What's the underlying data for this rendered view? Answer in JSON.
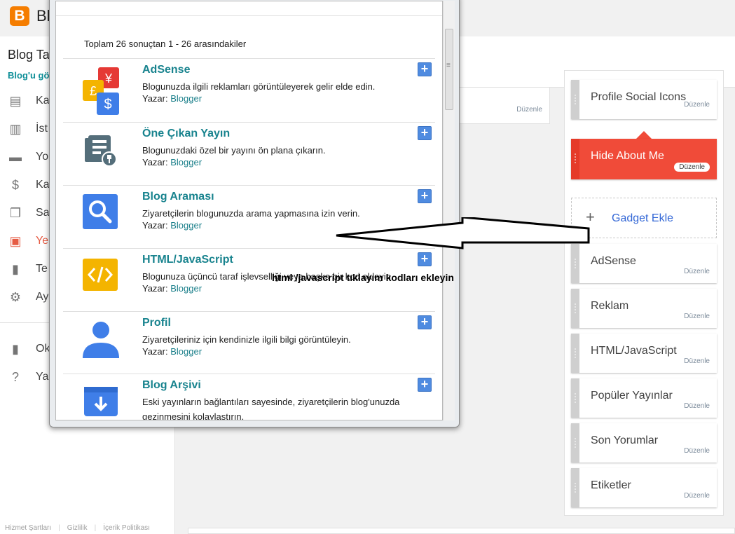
{
  "app": {
    "logo_letter": "B",
    "brand": "Bl"
  },
  "sidebar": {
    "blog_title": "Blog Ta",
    "blog_link": "Blog'u gö",
    "items": [
      {
        "label": "Ka",
        "icon": "posts-icon"
      },
      {
        "label": "İst",
        "icon": "stats-icon"
      },
      {
        "label": "Yo",
        "icon": "comments-icon"
      },
      {
        "label": "Ka",
        "icon": "earnings-icon"
      },
      {
        "label": "Sa",
        "icon": "pages-icon"
      },
      {
        "label": "Ye",
        "icon": "layout-icon",
        "active": true
      },
      {
        "label": "Te",
        "icon": "theme-icon"
      },
      {
        "label": "Ay",
        "icon": "settings-icon"
      },
      {
        "label": "Ok",
        "icon": "reading-list-icon"
      },
      {
        "label": "Ya",
        "icon": "help-icon"
      }
    ],
    "footer": [
      "Hizmet Şartları",
      "Gizlilik",
      "İçerik Politikası"
    ]
  },
  "middle": {
    "edit_label": "Düzenle"
  },
  "right": {
    "add_gadget": "Gadget Ekle",
    "gadgets": [
      {
        "name": "Profile Social Icons",
        "edit": "Düzenle"
      },
      {
        "name": "Hide About Me",
        "edit": "Düzenle",
        "highlighted": true
      },
      {
        "name": "AdSense",
        "edit": "Düzenle"
      },
      {
        "name": "Reklam",
        "edit": "Düzenle"
      },
      {
        "name": "HTML/JavaScript",
        "edit": "Düzenle"
      },
      {
        "name": "Popüler Yayınlar",
        "edit": "Düzenle"
      },
      {
        "name": "Son Yorumlar",
        "edit": "Düzenle"
      },
      {
        "name": "Etiketler",
        "edit": "Düzenle"
      }
    ]
  },
  "popup": {
    "results": "Toplam 26 sonuçtan 1 - 26 arasındakiler",
    "author_label": "Yazar:",
    "items": [
      {
        "title": "AdSense",
        "desc": "Blogunuzda ilgili reklamları görüntüleyerek gelir elde edin.",
        "author": "Blogger",
        "icon": "adsense-icon"
      },
      {
        "title": "Öne Çıkan Yayın",
        "desc": "Blogunuzdaki özel bir yayını ön plana çıkarın.",
        "author": "Blogger",
        "icon": "featured-post-icon"
      },
      {
        "title": "Blog Araması",
        "desc": "Ziyaretçilerin blogunuzda arama yapmasına izin verin.",
        "author": "Blogger",
        "icon": "search-icon"
      },
      {
        "title": "HTML/JavaScript",
        "desc": "Blogunuza üçüncü taraf işlevselliği veya başka bir kod ekleyin.",
        "author": "Blogger",
        "icon": "code-icon"
      },
      {
        "title": "Profil",
        "desc": "Ziyaretçileriniz için kendinizle ilgili bilgi görüntüleyin.",
        "author": "Blogger",
        "icon": "profile-icon"
      },
      {
        "title": "Blog Arşivi",
        "desc": "Eski yayınların bağlantıları sayesinde, ziyaretçilerin blog'unuzda gezinmesini kolaylaştırın.",
        "author": "",
        "icon": "archive-icon"
      }
    ]
  },
  "annotation": "html /javascript  tıklayım  kodları  ekleyin"
}
